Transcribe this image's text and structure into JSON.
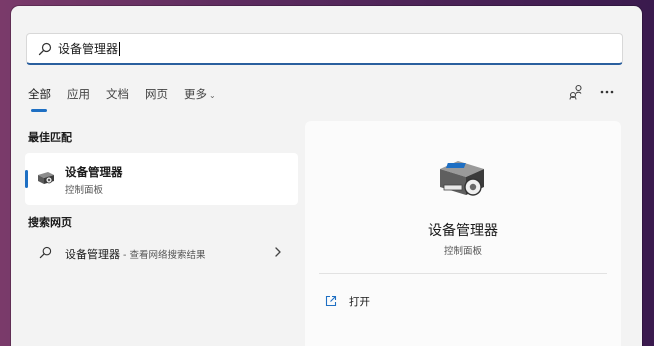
{
  "search": {
    "value": "设备管理器"
  },
  "tabs": [
    {
      "label": "全部",
      "active": true
    },
    {
      "label": "应用"
    },
    {
      "label": "文档"
    },
    {
      "label": "网页"
    },
    {
      "label": "更多"
    }
  ],
  "toolbar": {
    "share_icon": "people-link-icon",
    "more_icon": "ellipsis-icon"
  },
  "best_match": {
    "heading": "最佳匹配",
    "item": {
      "title": "设备管理器",
      "subtitle": "控制面板",
      "icon": "device-manager-icon"
    }
  },
  "web_search": {
    "heading": "搜索网页",
    "item": {
      "title": "设备管理器",
      "suffix": " - 查看网络搜索结果"
    }
  },
  "detail": {
    "title": "设备管理器",
    "subtitle": "控制面板",
    "actions": [
      {
        "label": "打开",
        "icon": "open-external-icon"
      }
    ]
  },
  "colors": {
    "accent": "#1e6fc3",
    "panel": "#f3f3f3"
  }
}
